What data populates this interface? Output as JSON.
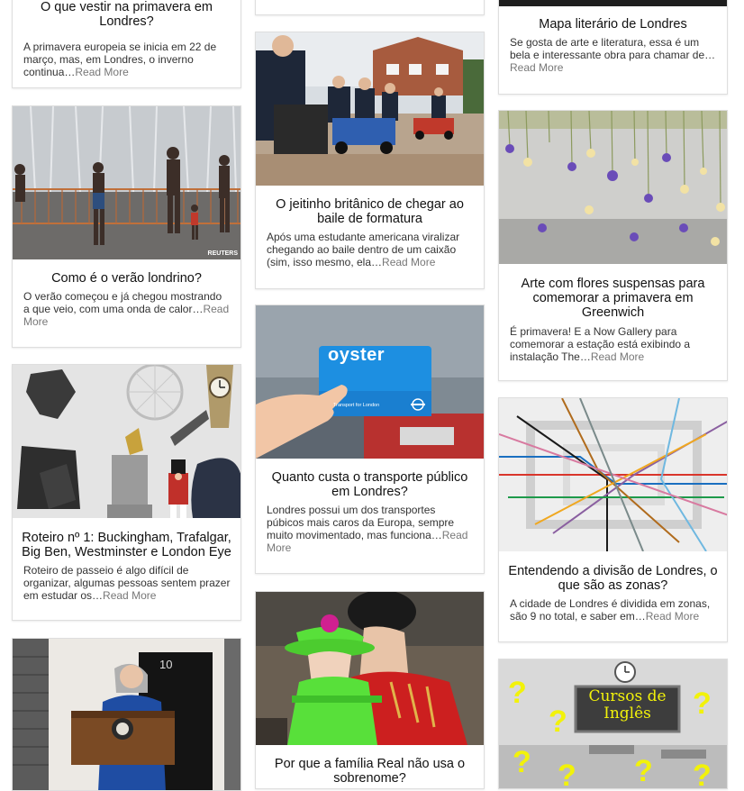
{
  "col1": [
    {
      "title": "O que vestir na primavera em Londres?",
      "excerpt": "A primavera europeia se inicia em 22 de março, mas, em Londres, o inverno continua",
      "more": "Read More"
    },
    {
      "title": "Como é o verão londrino?",
      "excerpt": "O verão começou e já chegou mostrando a que veio, com uma onda de calor",
      "more": "Read More",
      "watermark": "REUTERS"
    },
    {
      "title": "Roteiro nº 1: Buckingham, Trafalgar, Big Ben, Westminster e London Eye",
      "excerpt": "Roteiro de passeio é algo difícil de organizar, algumas pessoas sentem prazer em estudar os",
      "more": "Read More"
    },
    {
      "door_number": "10"
    }
  ],
  "col2": [
    {
      "title": "O jeitinho britânico de chegar ao baile de formatura",
      "excerpt": "Após uma estudante americana viralizar chegando ao baile dentro de um caixão (sim, isso mesmo, ela",
      "more": "Read More"
    },
    {
      "title": "Quanto custa o transporte público em Londres?",
      "excerpt": "Londres possui um dos transportes púbicos mais caros da Europa, sempre muito movimentado, mas funciona",
      "more": "Read More",
      "card_brand": "oyster",
      "card_sub": "Transport for London"
    },
    {
      "title": "Por que a família Real não usa o sobrenome?"
    }
  ],
  "col3": [
    {
      "title": "Mapa literário de Londres",
      "excerpt": "Se gosta de arte e literatura, essa é um bela e interessante obra para chamar de",
      "more": "Read More"
    },
    {
      "title": "Arte com flores suspensas para comemorar a primavera em Greenwich",
      "excerpt": "É primavera! E a Now Gallery para comemorar a estação está exibindo a instalação The",
      "more": "Read More"
    },
    {
      "title": "Entendendo a divisão de Londres, o que são as zonas?",
      "excerpt": "A cidade de Londres é dividida em zonas, são 9 no total, e saber em",
      "more": "Read More"
    },
    {
      "banner": "Cursos de Inglês"
    }
  ]
}
